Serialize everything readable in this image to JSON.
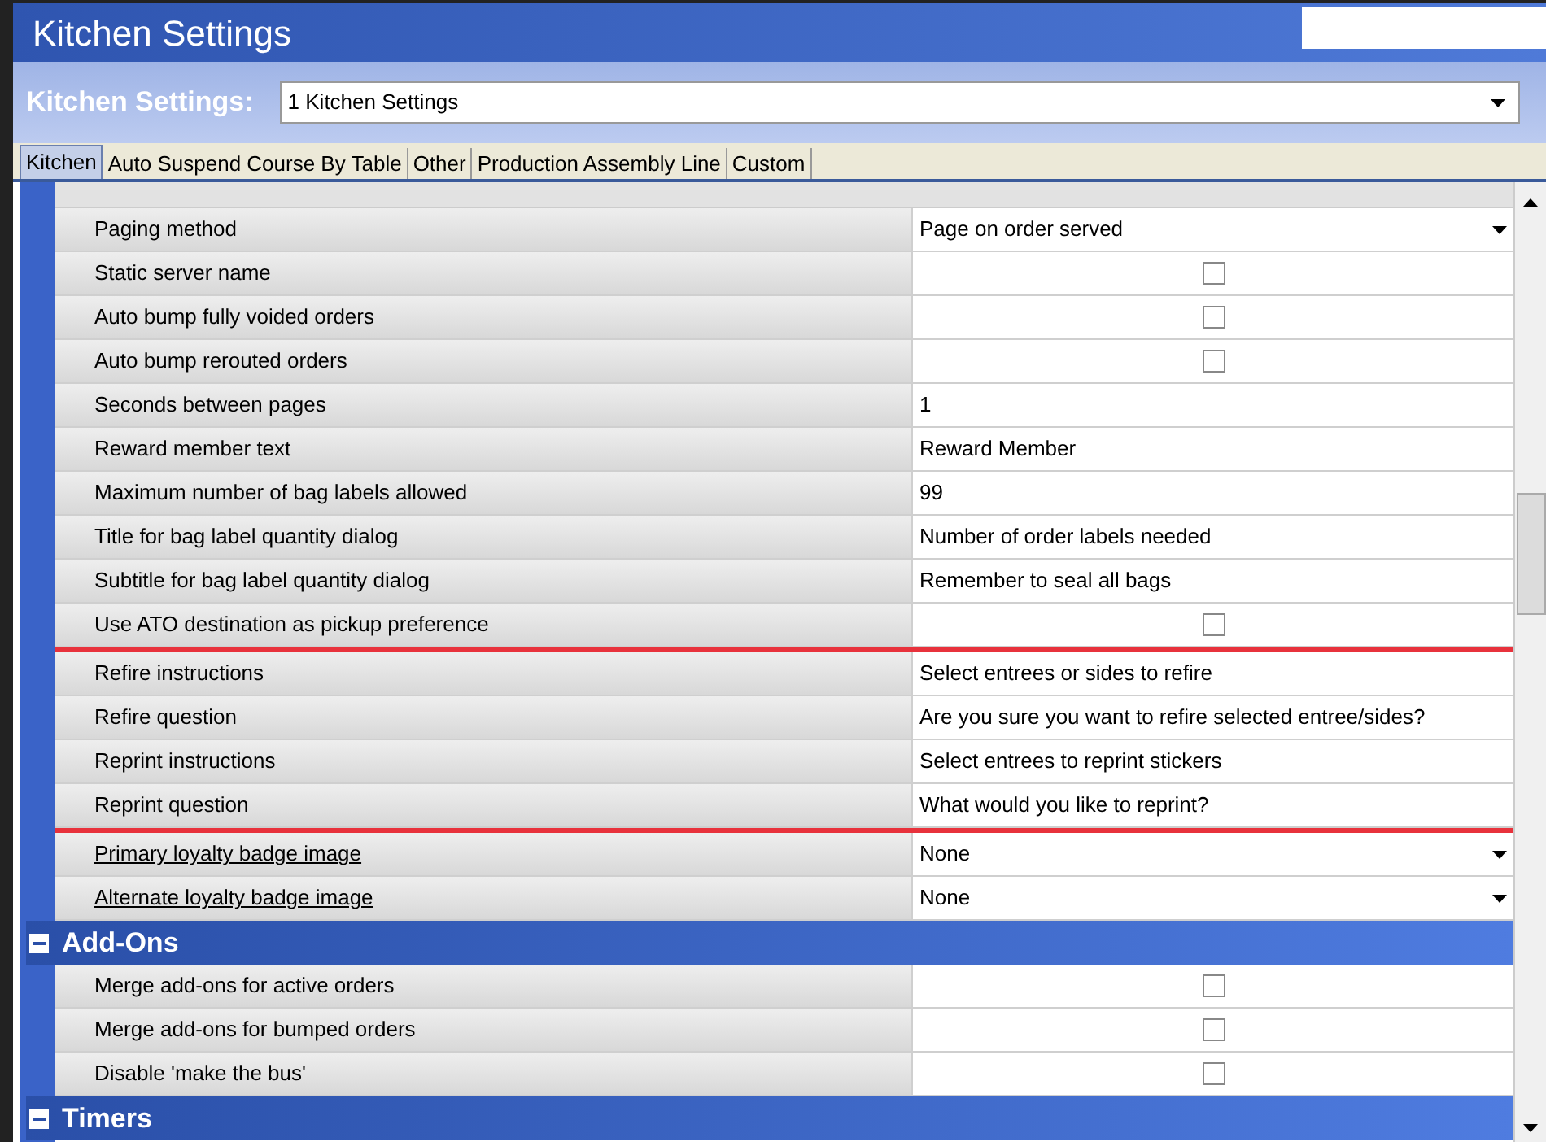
{
  "window": {
    "title": "Kitchen Settings"
  },
  "selector": {
    "label": "Kitchen Settings:",
    "value": "1 Kitchen Settings"
  },
  "tabs": [
    {
      "label": "Kitchen",
      "selected": true
    },
    {
      "label": "Auto Suspend Course By Table",
      "selected": false
    },
    {
      "label": "Other",
      "selected": false
    },
    {
      "label": "Production Assembly Line",
      "selected": false
    },
    {
      "label": "Custom",
      "selected": false
    }
  ],
  "sections": [
    {
      "rows": [
        {
          "label": "Paging method",
          "kind": "dropdown",
          "value": "Page on order served",
          "link": false
        },
        {
          "label": "Static server name",
          "kind": "checkbox",
          "checked": false,
          "link": false
        },
        {
          "label": "Auto bump fully voided orders",
          "kind": "checkbox",
          "checked": false,
          "link": false
        },
        {
          "label": "Auto bump rerouted orders",
          "kind": "checkbox",
          "checked": false,
          "link": false
        },
        {
          "label": "Seconds between pages",
          "kind": "text",
          "value": "1",
          "link": false
        },
        {
          "label": "Reward member text",
          "kind": "text",
          "value": "Reward Member",
          "link": false
        },
        {
          "label": "Maximum number of bag labels allowed",
          "kind": "text",
          "value": "99",
          "link": false
        },
        {
          "label": "Title for bag label quantity dialog",
          "kind": "text",
          "value": "Number of order labels needed",
          "link": false
        },
        {
          "label": "Subtitle for bag label quantity dialog",
          "kind": "text",
          "value": "Remember to seal all bags",
          "link": false
        },
        {
          "label": "Use ATO destination as pickup preference",
          "kind": "checkbox",
          "checked": false,
          "link": false
        },
        {
          "kind": "highlight_group",
          "rows": [
            {
              "label": "Refire instructions",
              "kind": "text",
              "value": "Select entrees or sides to refire",
              "link": false
            },
            {
              "label": "Refire question",
              "kind": "text",
              "value": "Are you sure you want to refire selected entree/sides?",
              "link": false
            },
            {
              "label": "Reprint instructions",
              "kind": "text",
              "value": "Select entrees to reprint stickers",
              "link": false
            },
            {
              "label": "Reprint question",
              "kind": "text",
              "value": "What would you like to reprint?",
              "link": false
            }
          ]
        },
        {
          "label": "Primary loyalty badge image",
          "kind": "dropdown",
          "value": "None",
          "link": true
        },
        {
          "label": "Alternate loyalty badge image",
          "kind": "dropdown",
          "value": "None",
          "link": true
        }
      ]
    },
    {
      "title": "Add-Ons",
      "expanded": true,
      "rows": [
        {
          "label": "Merge add-ons for active orders",
          "kind": "checkbox",
          "checked": false,
          "link": false
        },
        {
          "label": "Merge add-ons for bumped orders",
          "kind": "checkbox",
          "checked": false,
          "link": false
        },
        {
          "label": "Disable 'make the bus'",
          "kind": "checkbox",
          "checked": false,
          "link": false
        }
      ]
    },
    {
      "title": "Timers",
      "expanded": true
    }
  ]
}
